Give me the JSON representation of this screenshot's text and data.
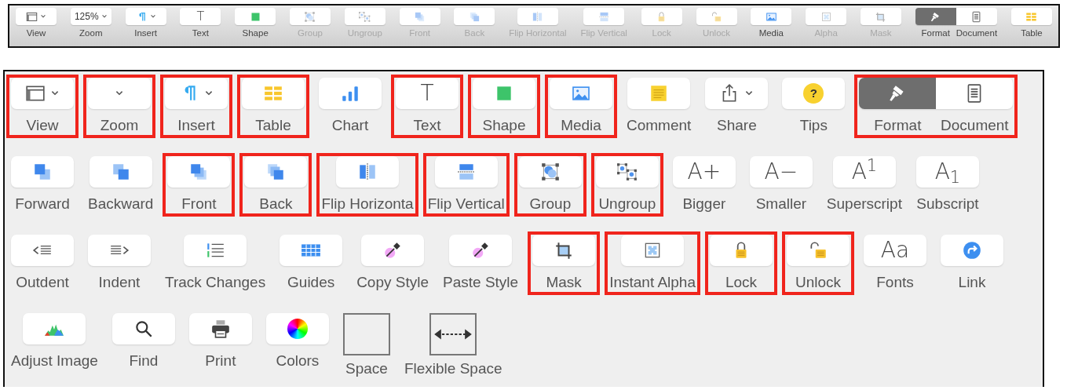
{
  "toolbar": {
    "items": [
      {
        "kind": "view",
        "label": "View",
        "disabled": false
      },
      {
        "kind": "zoom",
        "label": "Zoom",
        "value": "125%",
        "disabled": false
      },
      {
        "kind": "insert",
        "label": "Insert",
        "disabled": false
      },
      {
        "kind": "text",
        "label": "Text",
        "glyph": "T",
        "disabled": false
      },
      {
        "kind": "shape",
        "label": "Shape",
        "disabled": false
      },
      {
        "kind": "group",
        "label": "Group",
        "disabled": true
      },
      {
        "kind": "ungroup",
        "label": "Ungroup",
        "disabled": true
      },
      {
        "kind": "front",
        "label": "Front",
        "disabled": true
      },
      {
        "kind": "back",
        "label": "Back",
        "disabled": true
      },
      {
        "kind": "flip-horizontal",
        "label": "Flip Horizontal",
        "disabled": true
      },
      {
        "kind": "flip-vertical",
        "label": "Flip Vertical",
        "disabled": true
      },
      {
        "kind": "lock",
        "label": "Lock",
        "disabled": true
      },
      {
        "kind": "unlock",
        "label": "Unlock",
        "disabled": true
      },
      {
        "kind": "media",
        "label": "Media",
        "disabled": false
      },
      {
        "kind": "alpha",
        "label": "Alpha",
        "disabled": true
      },
      {
        "kind": "mask",
        "label": "Mask",
        "disabled": true
      },
      {
        "kind": "segmented",
        "segments": [
          {
            "kind": "format",
            "label": "Format",
            "selected": true
          },
          {
            "kind": "document",
            "label": "Document",
            "selected": false
          }
        ]
      },
      {
        "kind": "table",
        "label": "Table",
        "disabled": false
      }
    ]
  },
  "palette": {
    "rows": [
      {
        "items": [
          {
            "kind": "view",
            "label": "View",
            "highlighted": true
          },
          {
            "kind": "zoom",
            "label": "Zoom",
            "highlighted": true
          },
          {
            "kind": "insert",
            "label": "Insert",
            "highlighted": true
          },
          {
            "kind": "table",
            "label": "Table",
            "highlighted": true
          },
          {
            "kind": "chart",
            "label": "Chart",
            "highlighted": false
          },
          {
            "kind": "text",
            "label": "Text",
            "glyph": "T",
            "highlighted": true
          },
          {
            "kind": "shape",
            "label": "Shape",
            "highlighted": true
          },
          {
            "kind": "media",
            "label": "Media",
            "highlighted": true
          },
          {
            "kind": "comment",
            "label": "Comment",
            "highlighted": false
          },
          {
            "kind": "share",
            "label": "Share",
            "highlighted": false
          },
          {
            "kind": "tips",
            "label": "Tips",
            "glyph": "?",
            "highlighted": false
          },
          {
            "kind": "segmented",
            "highlighted": true,
            "segments": [
              {
                "kind": "format",
                "label": "Format",
                "selected": true
              },
              {
                "kind": "document",
                "label": "Document",
                "selected": false
              }
            ]
          }
        ]
      },
      {
        "items": [
          {
            "kind": "forward",
            "label": "Forward",
            "highlighted": false
          },
          {
            "kind": "backward",
            "label": "Backward",
            "highlighted": false
          },
          {
            "kind": "front",
            "label": "Front",
            "highlighted": true
          },
          {
            "kind": "back",
            "label": "Back",
            "highlighted": true
          },
          {
            "kind": "flip-horizontal",
            "label": "Flip Horizonta",
            "highlighted": true
          },
          {
            "kind": "flip-vertical",
            "label": "Flip Vertical",
            "highlighted": true
          },
          {
            "kind": "group",
            "label": "Group",
            "highlighted": true
          },
          {
            "kind": "ungroup",
            "label": "Ungroup",
            "highlighted": true
          },
          {
            "kind": "bigger",
            "label": "Bigger",
            "glyph": "A+",
            "highlighted": false
          },
          {
            "kind": "smaller",
            "label": "Smaller",
            "glyph": "A−",
            "highlighted": false
          },
          {
            "kind": "superscript",
            "label": "Superscript",
            "glyph": "A$^{1}$",
            "highlighted": false
          },
          {
            "kind": "subscript",
            "label": "Subscript",
            "glyph": "A$_{1}$",
            "highlighted": false
          }
        ]
      },
      {
        "items": [
          {
            "kind": "outdent",
            "label": "Outdent",
            "highlighted": false
          },
          {
            "kind": "indent",
            "label": "Indent",
            "highlighted": false
          },
          {
            "kind": "track-changes",
            "label": "Track Changes",
            "highlighted": false
          },
          {
            "kind": "guides",
            "label": "Guides",
            "highlighted": false
          },
          {
            "kind": "copy-style",
            "label": "Copy Style",
            "highlighted": false
          },
          {
            "kind": "paste-style",
            "label": "Paste Style",
            "highlighted": false
          },
          {
            "kind": "mask",
            "label": "Mask",
            "highlighted": true
          },
          {
            "kind": "alpha",
            "label": "Instant Alpha",
            "highlighted": true
          },
          {
            "kind": "lock",
            "label": "Lock",
            "highlighted": true
          },
          {
            "kind": "unlock",
            "label": "Unlock",
            "highlighted": true
          },
          {
            "kind": "fonts",
            "label": "Fonts",
            "glyph": "Aa",
            "highlighted": false
          },
          {
            "kind": "link",
            "label": "Link",
            "highlighted": false
          }
        ]
      },
      {
        "items": [
          {
            "kind": "adjust-image",
            "label": "Adjust Image",
            "highlighted": false
          },
          {
            "kind": "find",
            "label": "Find",
            "highlighted": false
          },
          {
            "kind": "print",
            "label": "Print",
            "highlighted": false
          },
          {
            "kind": "colors",
            "label": "Colors",
            "highlighted": false
          },
          {
            "kind": "space",
            "label": "Space",
            "highlighted": false
          },
          {
            "kind": "flexible-space",
            "label": "Flexible Space",
            "highlighted": false
          }
        ]
      }
    ]
  }
}
